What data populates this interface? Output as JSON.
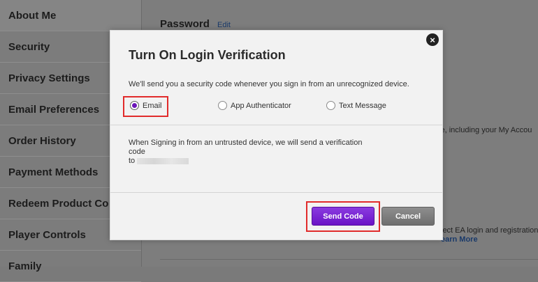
{
  "sidebar": {
    "items": [
      {
        "label": "About Me"
      },
      {
        "label": "Security"
      },
      {
        "label": "Privacy Settings"
      },
      {
        "label": "Email Preferences"
      },
      {
        "label": "Order History"
      },
      {
        "label": "Payment Methods"
      },
      {
        "label": "Redeem Product Co"
      },
      {
        "label": "Player Controls"
      },
      {
        "label": "Family"
      }
    ]
  },
  "background": {
    "password_label": "Password",
    "edit_link": "Edit",
    "fragment_1": "ce, including your My Accou",
    "fragment_2": "lect EA login and registration",
    "learn_more": "earn More"
  },
  "modal": {
    "title": "Turn On Login Verification",
    "description": "We'll send you a security code whenever you sign in from an unrecognized device.",
    "options": [
      {
        "label": "Email",
        "selected": true
      },
      {
        "label": "App Authenticator",
        "selected": false
      },
      {
        "label": "Text Message",
        "selected": false
      }
    ],
    "info_line_1": "When Signing in from an untrusted device, we will send a verification code",
    "info_line_2": "to",
    "send_label": "Send Code",
    "cancel_label": "Cancel",
    "close_glyph": "×"
  },
  "colors": {
    "accent": "#6b15b8",
    "highlight": "#e12b2b",
    "overlay": "#7a7a7a"
  }
}
